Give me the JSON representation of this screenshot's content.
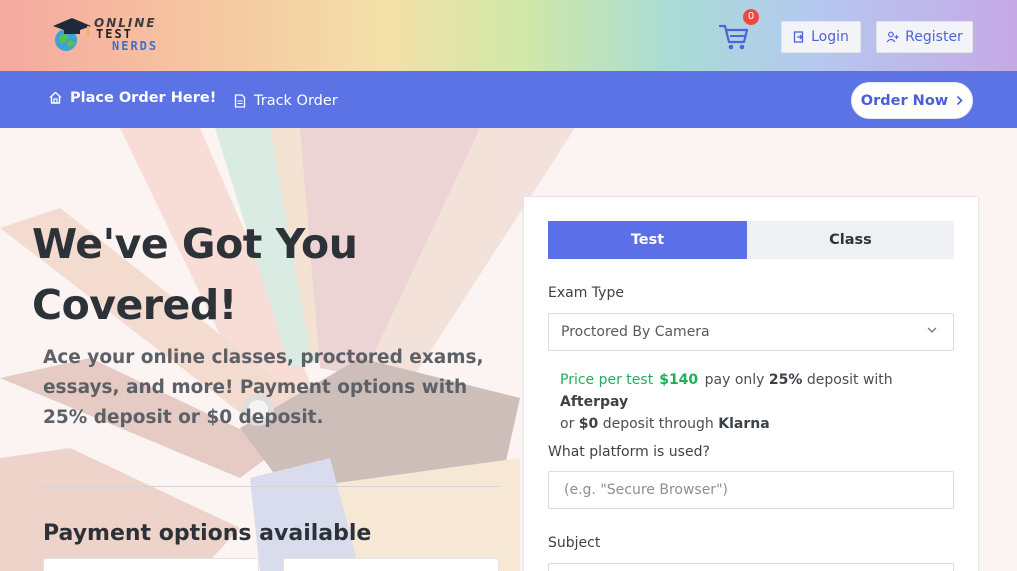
{
  "header": {
    "logo": {
      "line1": "ONLINE",
      "line2": "TEST",
      "line3": "NERDS"
    },
    "cart_count": "0",
    "login_label": "Login",
    "register_label": "Register"
  },
  "nav": {
    "place_order": "Place Order Here!",
    "track_order": "Track Order",
    "order_now": "Order Now"
  },
  "hero": {
    "title_line1": "We've Got You",
    "title_line2": "Covered!",
    "subtitle": "Ace your online classes, proctored exams, essays, and more! Payment options with 25% deposit or $0 deposit.",
    "payment_title": "Payment options available"
  },
  "form": {
    "tabs": [
      {
        "label": "Test",
        "active": true
      },
      {
        "label": "Class",
        "active": false
      }
    ],
    "exam_type_label": "Exam Type",
    "exam_type_value": "Proctored By Camera",
    "price": {
      "prefix": "Price per test",
      "amount": "$140",
      "text1": "pay only",
      "deposit": "25%",
      "text2": "deposit with",
      "afterpay": "Afterpay",
      "text3": "or",
      "zero": "$0",
      "text4": "deposit through",
      "klarna": "Klarna"
    },
    "platform_label": "What platform is used?",
    "platform_placeholder": "(e.g. \"Secure Browser\")",
    "subject_label": "Subject"
  },
  "colors": {
    "primary": "#5b73e4",
    "tab_active": "#5b6fe8",
    "price_green": "#1fae5a",
    "badge_red": "#f0483e"
  }
}
